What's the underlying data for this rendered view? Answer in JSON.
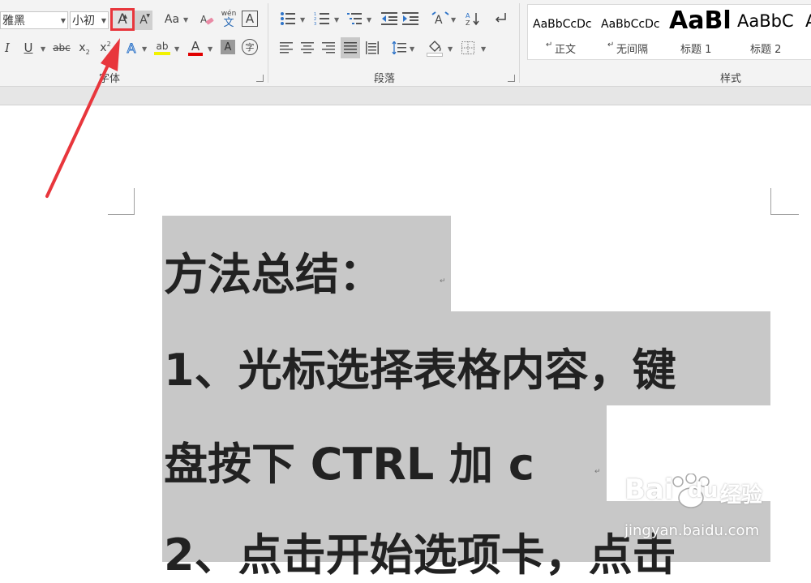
{
  "ribbon": {
    "font_group": {
      "font_name": "雅黑",
      "font_size": "小初",
      "grow_font_icon": "A",
      "shrink_font_icon": "A",
      "change_case": "Aa",
      "pinyin_top": "wén",
      "pinyin_bottom": "文",
      "char_border": "A",
      "italic": "I",
      "underline": "U",
      "strikethrough": "abc",
      "subscript": "x",
      "superscript": "x",
      "text_effects": "A",
      "highlight": "ab",
      "font_color": "A",
      "char_shading": "A",
      "enclose_char": "字",
      "label": "字体"
    },
    "paragraph_group": {
      "label": "段落"
    },
    "styles_group": {
      "label": "样式",
      "items": [
        {
          "preview": "AaBbCcDc",
          "name": "正文",
          "mark": "↵"
        },
        {
          "preview": "AaBbCcDc",
          "name": "无间隔",
          "mark": "↵"
        },
        {
          "preview": "AaBl",
          "name": "标题 1"
        },
        {
          "preview": "AaBbC",
          "name": "标题 2"
        },
        {
          "preview": "A",
          "name": ""
        }
      ]
    }
  },
  "document": {
    "lines": [
      "方法总结：",
      "1、光标选择表格内容，键",
      "盘按下 CTRL 加 c",
      "2、点击开始选项卡，点击"
    ],
    "paragraph_mark": "↵"
  },
  "annotation": {
    "highlight_color": "#e8363c"
  },
  "watermark": {
    "text_main": "Bai",
    "text_du": "du",
    "text_cn": "经验",
    "url": "jingyan.baidu.com"
  },
  "colors": {
    "selection": "#c8c8c8",
    "text": "#222222",
    "font_color_bar": "#e00000",
    "highlight_bar": "#f2f200"
  }
}
